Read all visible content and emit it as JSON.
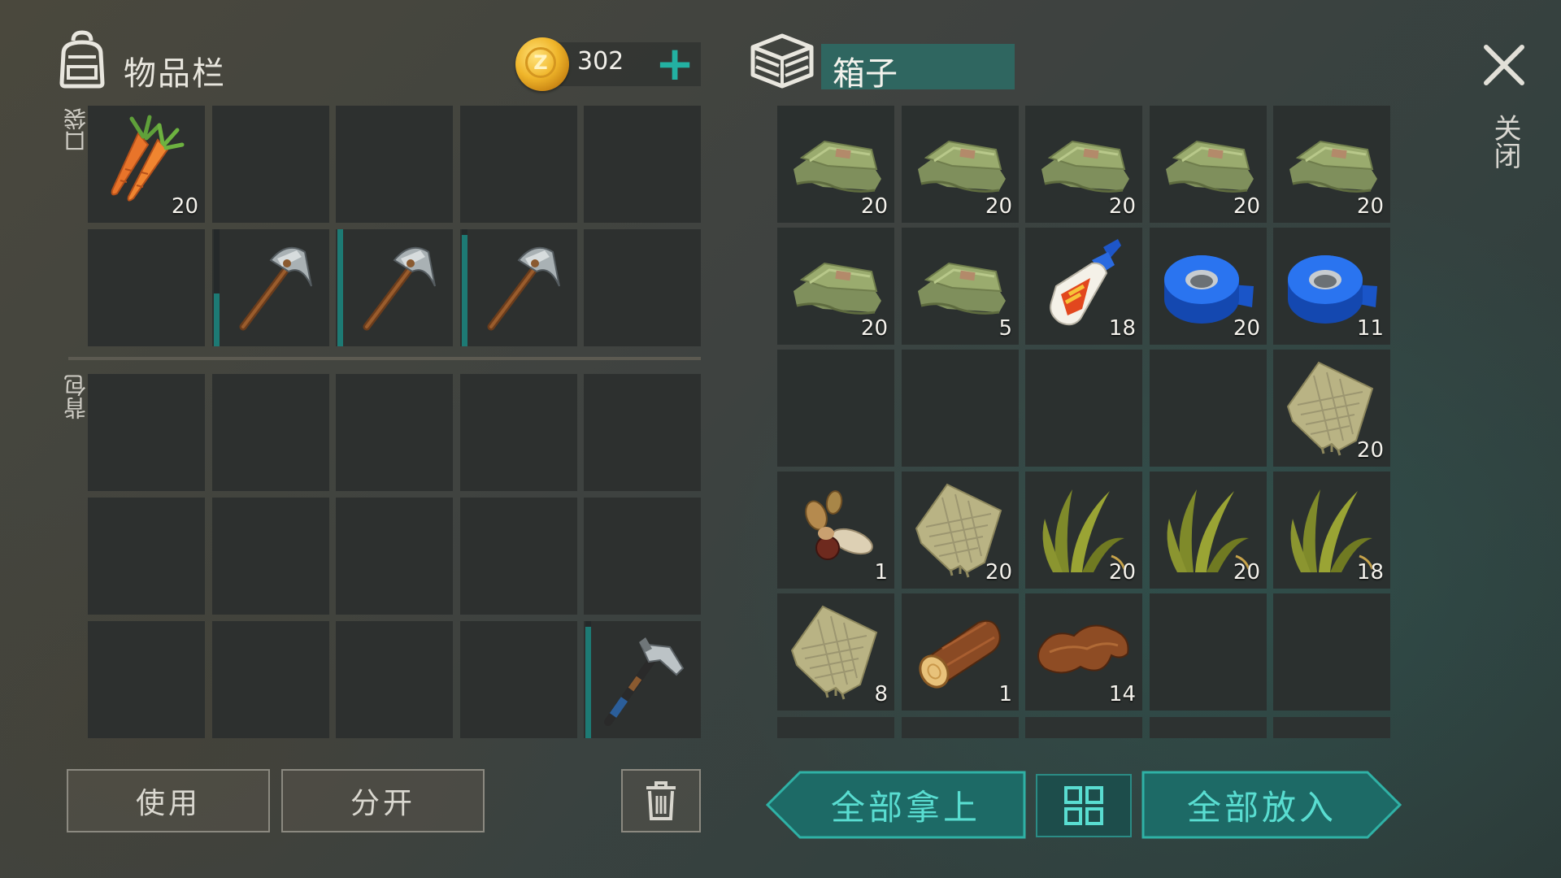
{
  "inventory": {
    "title": "物品栏",
    "coins": "302",
    "pocket_label": "口袋",
    "backpack_label": "背包",
    "pocket_slots": [
      {
        "item": "carrot-icon",
        "count": "20"
      },
      {
        "item": "",
        "count": ""
      },
      {
        "item": "",
        "count": ""
      },
      {
        "item": "",
        "count": ""
      },
      {
        "item": "",
        "count": ""
      },
      {
        "item": "",
        "count": ""
      },
      {
        "item": "pickaxe-icon",
        "count": "",
        "durability": 0.45
      },
      {
        "item": "pickaxe-icon",
        "count": "",
        "durability": 1.0
      },
      {
        "item": "pickaxe-icon",
        "count": "",
        "durability": 0.95
      },
      {
        "item": "",
        "count": ""
      }
    ],
    "backpack_slots": [
      {
        "item": "",
        "count": ""
      },
      {
        "item": "",
        "count": ""
      },
      {
        "item": "",
        "count": ""
      },
      {
        "item": "",
        "count": ""
      },
      {
        "item": "",
        "count": ""
      },
      {
        "item": "",
        "count": ""
      },
      {
        "item": "",
        "count": ""
      },
      {
        "item": "",
        "count": ""
      },
      {
        "item": "",
        "count": ""
      },
      {
        "item": "",
        "count": ""
      },
      {
        "item": "",
        "count": ""
      },
      {
        "item": "",
        "count": ""
      },
      {
        "item": "",
        "count": ""
      },
      {
        "item": "",
        "count": ""
      },
      {
        "item": "hatchet-icon",
        "count": "",
        "durability": 0.95
      }
    ],
    "use_label": "使用",
    "split_label": "分开"
  },
  "box": {
    "title": "箱子",
    "close_label": "关闭",
    "slots": [
      {
        "item": "cloth-icon",
        "count": "20"
      },
      {
        "item": "cloth-icon",
        "count": "20"
      },
      {
        "item": "cloth-icon",
        "count": "20"
      },
      {
        "item": "cloth-icon",
        "count": "20"
      },
      {
        "item": "cloth-icon",
        "count": "20"
      },
      {
        "item": "cloth-icon",
        "count": "20"
      },
      {
        "item": "cloth-icon",
        "count": "5"
      },
      {
        "item": "glue-icon",
        "count": "18"
      },
      {
        "item": "tape-icon",
        "count": "20"
      },
      {
        "item": "tape-icon",
        "count": "11"
      },
      {
        "item": "",
        "count": ""
      },
      {
        "item": "",
        "count": ""
      },
      {
        "item": "",
        "count": ""
      },
      {
        "item": "",
        "count": ""
      },
      {
        "item": "burlap-icon",
        "count": "20"
      },
      {
        "item": "seeds-icon",
        "count": "1"
      },
      {
        "item": "burlap-icon",
        "count": "20"
      },
      {
        "item": "grass-icon",
        "count": "20"
      },
      {
        "item": "grass-icon",
        "count": "20"
      },
      {
        "item": "grass-icon",
        "count": "18"
      },
      {
        "item": "burlap-icon",
        "count": "8"
      },
      {
        "item": "log-icon",
        "count": "1"
      },
      {
        "item": "leather-icon",
        "count": "14"
      },
      {
        "item": "",
        "count": ""
      },
      {
        "item": "",
        "count": ""
      }
    ],
    "take_all_label": "全部拿上",
    "put_all_label": "全部放入"
  }
}
